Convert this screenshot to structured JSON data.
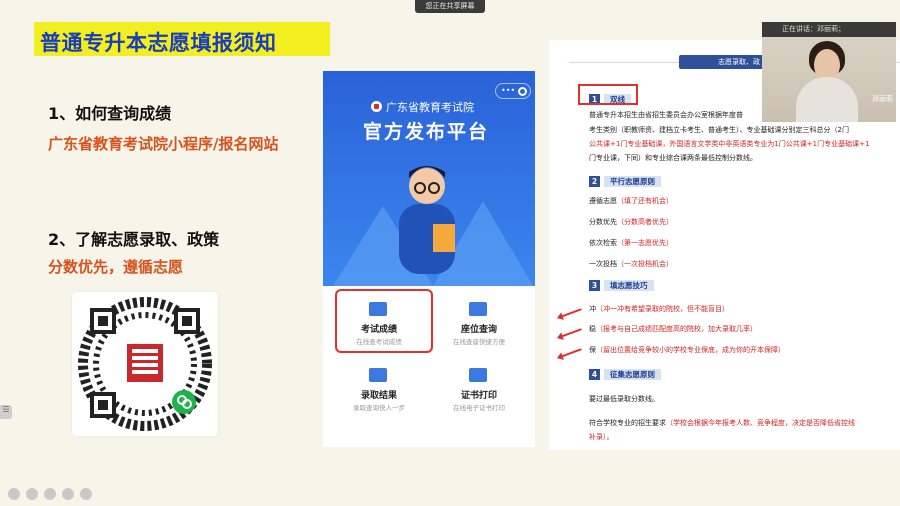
{
  "share_banner": "您正在共享屏幕",
  "slide": {
    "title": "普通专升本志愿填报须知",
    "q1": "1、如何查询成绩",
    "a1": "广东省教育考试院小程序/报名网站",
    "q2": "2、了解志愿录取、政策",
    "a2": "分数优先，遵循志愿"
  },
  "phone": {
    "org": "广东省教育考试院",
    "platform": "官方发布平台",
    "tiles": [
      {
        "name": "考试成绩",
        "sub": "在线查考试成绩"
      },
      {
        "name": "座位查询",
        "sub": "在线查座快捷方便"
      },
      {
        "name": "录取结果",
        "sub": "录取查询快人一步"
      },
      {
        "name": "证书打印",
        "sub": "在线电子证书打印"
      }
    ]
  },
  "doc": {
    "tag": "志愿录取、政",
    "sec1_num": "1",
    "sec1": "双线",
    "l1": "普通专升本招生由省招生委员会办公室根据年度普",
    "l2": "考生类别（职教师资、建档立卡考生、普通考生）、专业基础课分别定三科总分（2门",
    "l3": "公共课+1门专业基础课，外国语言文学类中非英语类专业为1门公共课+1门专业基础课+1",
    "l4": "门专业课，下同）和专业综合课两条最低控制分数线。",
    "sec2_num": "2",
    "sec2": "平行志愿原则",
    "p1a": "遵循志愿",
    "p1b": "（填了还有机会）",
    "p2a": "分数优先",
    "p2b": "（分数高者优先）",
    "p3a": "依次检索",
    "p3b": "（第一志愿优先）",
    "p4a": "一次投档",
    "p4b": "（一次投档机会）",
    "sec3_num": "3",
    "sec3": "填志愿技巧",
    "t1a": "冲",
    "t1b": "（冲一冲有希望录取的院校，但不能盲目）",
    "t2a": "稳",
    "t2b": "（报考与自己成绩匹配度高的院校，加大录取几率）",
    "t3a": "保",
    "t3b": "（留出位置给竞争较小的学校专业保底，成为你的开本保障）",
    "sec4_num": "4",
    "sec4": "征集志愿原则",
    "e1": "要过最低录取分数线。",
    "e2a": "符合学校专业的招生要求",
    "e2b": "（学校会根据今年报考人数、竞争程度，决定是否降低省控线",
    "e3": "补录）。"
  },
  "camera": {
    "status": "正在讲话：邓丽莉；",
    "name": "邓丽莉"
  }
}
